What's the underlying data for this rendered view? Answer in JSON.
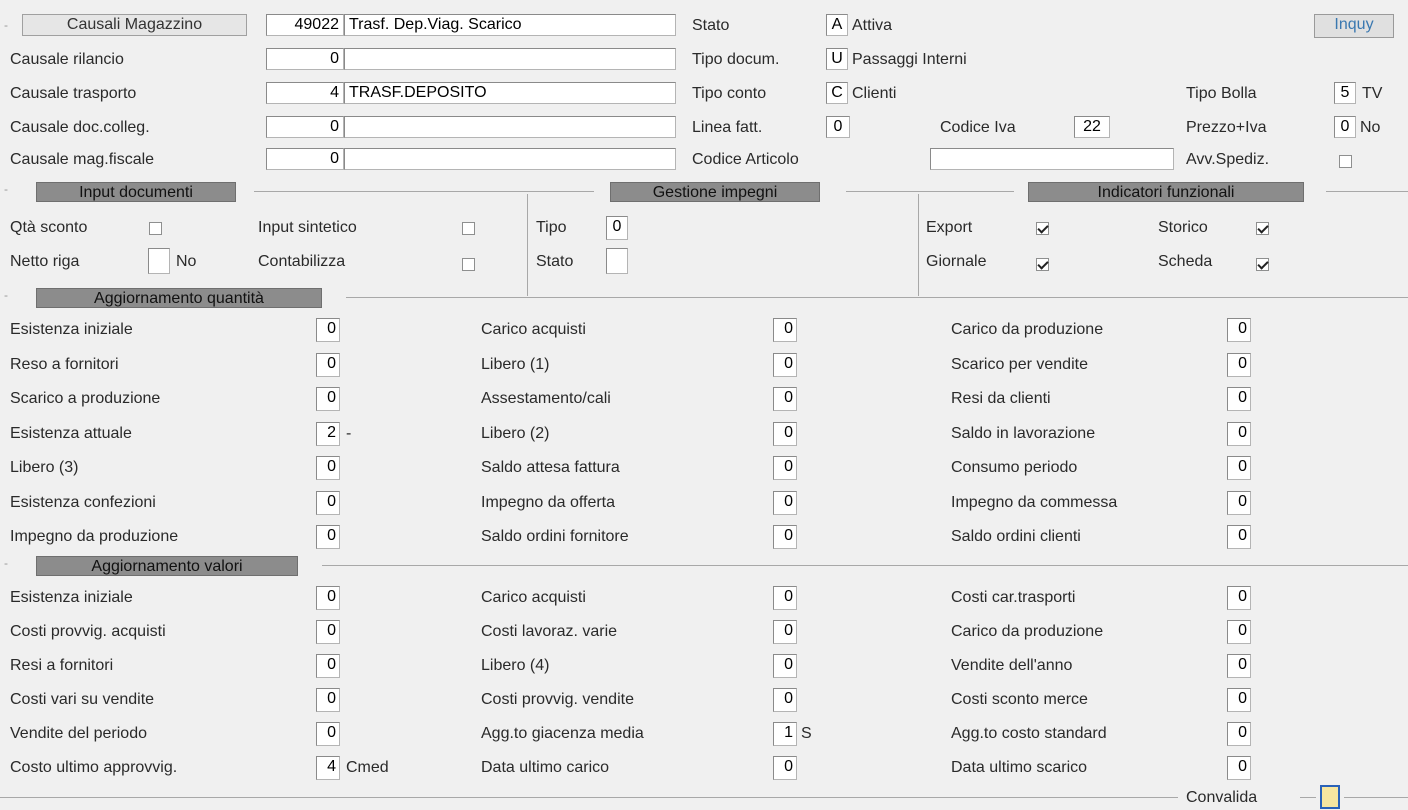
{
  "header": {
    "button": "Causali Magazzino",
    "code": "49022",
    "description": "Trasf. Dep.Viag. Scarico",
    "inquiry_button": "Inquy"
  },
  "top_left": [
    {
      "label": "Causale rilancio",
      "value": "0",
      "text": ""
    },
    {
      "label": "Causale trasporto",
      "value": "4",
      "text": "TRASF.DEPOSITO"
    },
    {
      "label": "Causale doc.colleg.",
      "value": "0",
      "text": ""
    },
    {
      "label": "Causale mag.fiscale",
      "value": "0",
      "text": ""
    }
  ],
  "top_mid": {
    "stato": {
      "label": "Stato",
      "code": "A",
      "text": "Attiva"
    },
    "tipo_docum": {
      "label": "Tipo docum.",
      "code": "U",
      "text": "Passaggi Interni"
    },
    "tipo_conto": {
      "label": "Tipo conto",
      "code": "C",
      "text": "Clienti"
    },
    "linea_fatt": {
      "label": "Linea fatt.",
      "code": "0"
    },
    "codice_iva": {
      "label": "Codice Iva",
      "code": "22"
    },
    "codice_articolo": {
      "label": "Codice Articolo",
      "value": ""
    }
  },
  "top_right": {
    "tipo_bolla": {
      "label": "Tipo Bolla",
      "code": "5",
      "text": "TV"
    },
    "prezzo_iva": {
      "label": "Prezzo+Iva",
      "code": "0",
      "text": "No"
    },
    "avv_spediz": {
      "label": "Avv.Spediz.",
      "checked": false
    }
  },
  "sections": {
    "input_documenti": "Input documenti",
    "gestione_impegni": "Gestione impegni",
    "indicatori_funzionali": "Indicatori funzionali",
    "aggiornamento_quantita": "Aggiornamento quantità",
    "aggiornamento_valori": "Aggiornamento valori"
  },
  "input_documenti": {
    "qta_sconto": {
      "label": "Qtà sconto",
      "checked": false
    },
    "netto_riga": {
      "label": "Netto riga",
      "value": "",
      "text": "No"
    },
    "input_sintetico": {
      "label": "Input sintetico",
      "checked": false
    },
    "contabilizza": {
      "label": "Contabilizza",
      "checked": false
    }
  },
  "gestione_impegni": {
    "tipo": {
      "label": "Tipo",
      "value": "0"
    },
    "stato": {
      "label": "Stato",
      "value": ""
    }
  },
  "indicatori": {
    "export": {
      "label": "Export",
      "checked": true
    },
    "giornale": {
      "label": "Giornale",
      "checked": true
    },
    "storico": {
      "label": "Storico",
      "checked": true
    },
    "scheda": {
      "label": "Scheda",
      "checked": true
    }
  },
  "quantita": [
    [
      {
        "label": "Esistenza iniziale",
        "value": "0",
        "suffix": ""
      },
      {
        "label": "Carico acquisti",
        "value": "0",
        "suffix": ""
      },
      {
        "label": "Carico da produzione",
        "value": "0",
        "suffix": ""
      }
    ],
    [
      {
        "label": "Reso   a fornitori",
        "value": "0",
        "suffix": ""
      },
      {
        "label": "Libero (1)",
        "value": "0",
        "suffix": ""
      },
      {
        "label": "Scarico per vendite",
        "value": "0",
        "suffix": ""
      }
    ],
    [
      {
        "label": "Scarico a produzione",
        "value": "0",
        "suffix": ""
      },
      {
        "label": "Assestamento/cali",
        "value": "0",
        "suffix": ""
      },
      {
        "label": "Resi  da clienti",
        "value": "0",
        "suffix": ""
      }
    ],
    [
      {
        "label": "Esistenza attuale",
        "value": "2",
        "suffix": "-"
      },
      {
        "label": "Libero (2)",
        "value": "0",
        "suffix": ""
      },
      {
        "label": "Saldo in lavorazione",
        "value": "0",
        "suffix": ""
      }
    ],
    [
      {
        "label": "Libero (3)",
        "value": "0",
        "suffix": ""
      },
      {
        "label": "Saldo attesa fattura",
        "value": "0",
        "suffix": ""
      },
      {
        "label": "Consumo periodo",
        "value": "0",
        "suffix": ""
      }
    ],
    [
      {
        "label": "Esistenza confezioni",
        "value": "0",
        "suffix": ""
      },
      {
        "label": "Impegno da offerta",
        "value": "0",
        "suffix": ""
      },
      {
        "label": "Impegno da commessa",
        "value": "0",
        "suffix": ""
      }
    ],
    [
      {
        "label": "Impegno da produzione",
        "value": "0",
        "suffix": ""
      },
      {
        "label": "Saldo ordini fornitore",
        "value": "0",
        "suffix": ""
      },
      {
        "label": "Saldo ordini clienti",
        "value": "0",
        "suffix": ""
      }
    ]
  ],
  "valori": [
    [
      {
        "label": "Esistenza iniziale",
        "value": "0",
        "suffix": ""
      },
      {
        "label": "Carico acquisti",
        "value": "0",
        "suffix": ""
      },
      {
        "label": "Costi  car.trasporti",
        "value": "0",
        "suffix": ""
      }
    ],
    [
      {
        "label": "Costi provvig. acquisti",
        "value": "0",
        "suffix": ""
      },
      {
        "label": "Costi lavoraz. varie",
        "value": "0",
        "suffix": ""
      },
      {
        "label": "Carico da produzione",
        "value": "0",
        "suffix": ""
      }
    ],
    [
      {
        "label": "Resi a fornitori",
        "value": "0",
        "suffix": ""
      },
      {
        "label": "Libero (4)",
        "value": "0",
        "suffix": ""
      },
      {
        "label": "Vendite dell'anno",
        "value": "0",
        "suffix": ""
      }
    ],
    [
      {
        "label": "Costi vari su vendite",
        "value": "0",
        "suffix": ""
      },
      {
        "label": "Costi provvig. vendite",
        "value": "0",
        "suffix": ""
      },
      {
        "label": "Costi sconto merce",
        "value": "0",
        "suffix": ""
      }
    ],
    [
      {
        "label": "Vendite del periodo",
        "value": "0",
        "suffix": ""
      },
      {
        "label": "Agg.to giacenza media",
        "value": "1",
        "suffix": "S"
      },
      {
        "label": "Agg.to costo standard",
        "value": "0",
        "suffix": ""
      }
    ],
    [
      {
        "label": "Costo ultimo approvvig.",
        "value": "4",
        "suffix": "Cmed"
      },
      {
        "label": "Data ultimo carico",
        "value": "0",
        "suffix": ""
      },
      {
        "label": "Data ultimo scarico",
        "value": "0",
        "suffix": ""
      }
    ]
  ],
  "footer": {
    "convalida_label": "Convalida"
  },
  "colors": {
    "background": "#f0f0f0",
    "section_header": "#8c8c8c",
    "inquiry_text": "#3a78b0"
  }
}
